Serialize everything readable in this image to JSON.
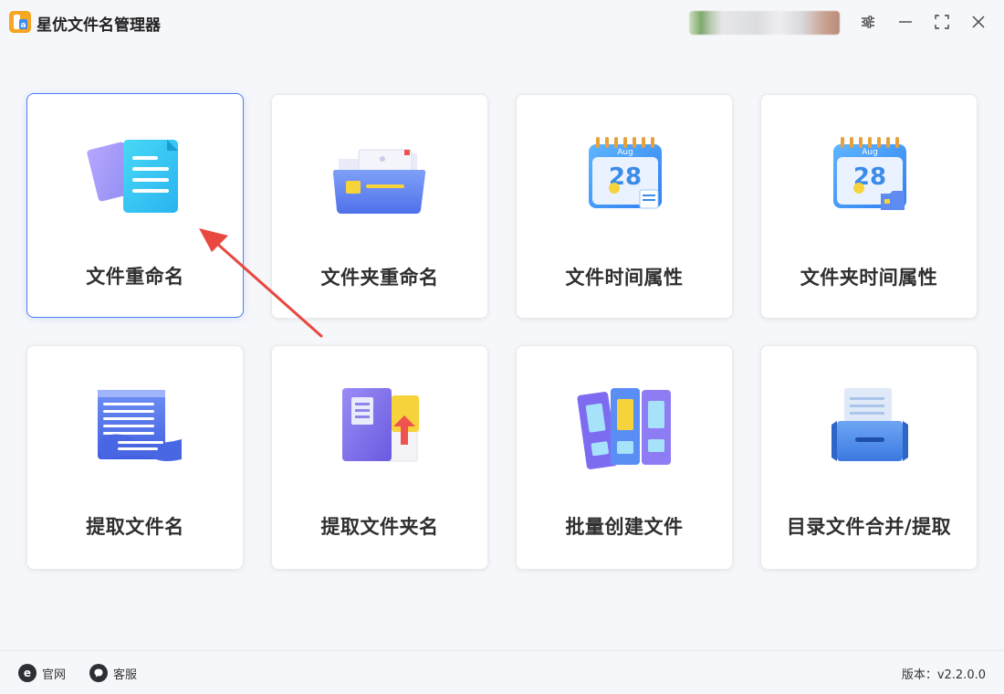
{
  "app": {
    "title": "星优文件名管理器",
    "logo_letter": "a",
    "accent_color": "#4d7cf5",
    "logo_color": "#f5a623"
  },
  "window_controls": {
    "settings_icon": "sliders-icon",
    "minimize_icon": "minimize-icon",
    "maximize_icon": "maximize-icon",
    "close_icon": "close-icon"
  },
  "tools": [
    {
      "label": "文件重命名",
      "icon": "document-rename-icon",
      "active": true
    },
    {
      "label": "文件夹重命名",
      "icon": "folder-rename-icon",
      "active": false
    },
    {
      "label": "文件时间属性",
      "icon": "calendar-file-icon",
      "active": false
    },
    {
      "label": "文件夹时间属性",
      "icon": "calendar-folder-icon",
      "active": false
    },
    {
      "label": "提取文件名",
      "icon": "scroll-list-icon",
      "active": false
    },
    {
      "label": "提取文件夹名",
      "icon": "book-folder-icon",
      "active": false
    },
    {
      "label": "批量创建文件",
      "icon": "binders-icon",
      "active": false
    },
    {
      "label": "目录文件合并/提取",
      "icon": "file-drawer-icon",
      "active": false
    }
  ],
  "calendar_month": "Aug",
  "calendar_day": "28",
  "footer": {
    "website_label": "官网",
    "website_icon_letter": "e",
    "support_label": "客服",
    "version_text": "版本：v2.2.0.0"
  }
}
